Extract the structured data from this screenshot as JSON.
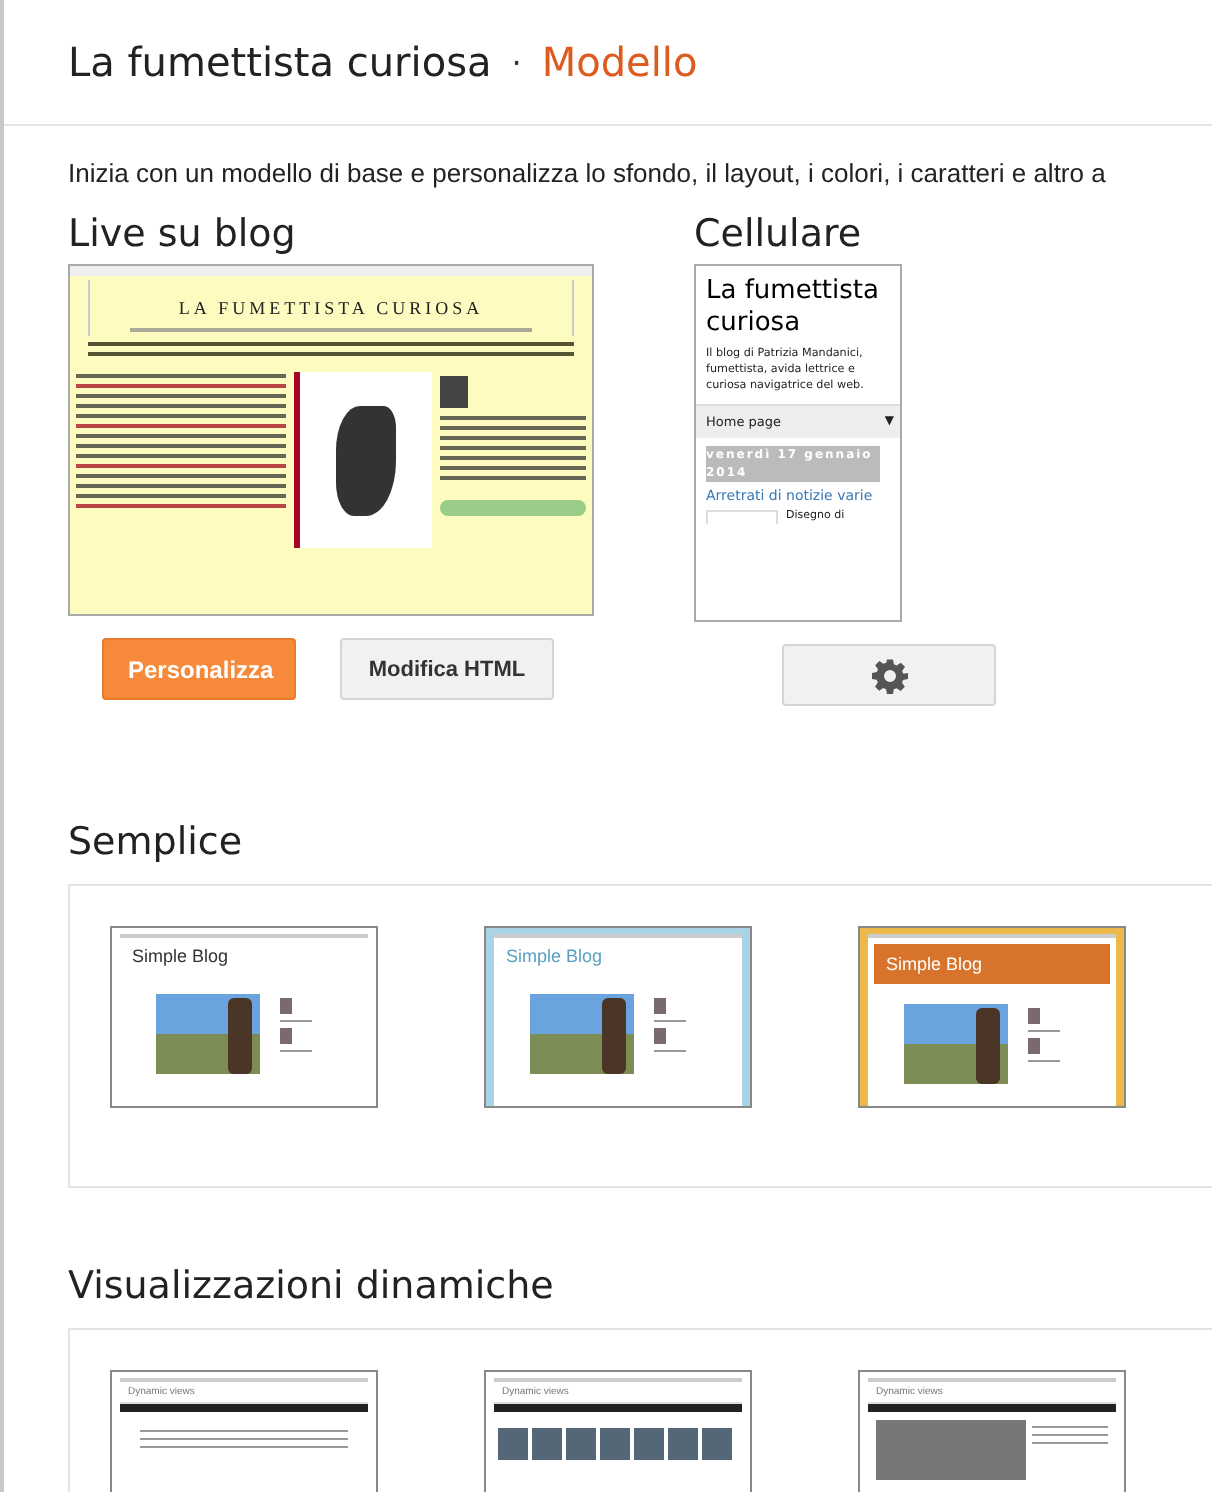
{
  "header": {
    "blog_name": "La fumettista curiosa",
    "separator": "·",
    "page": "Modello"
  },
  "intro": "Inizia con un modello di base e personalizza lo sfondo, il layout, i colori, i caratteri e altro a",
  "live": {
    "heading": "Live su blog",
    "preview_title": "LA FUMETTISTA CURIOSA",
    "buttons": [
      {
        "label": "Personalizza",
        "kind": "primary"
      },
      {
        "label": "Modifica HTML",
        "kind": "secondary"
      }
    ]
  },
  "mobile": {
    "heading": "Cellulare",
    "title": "La fumettista curiosa",
    "description": "Il blog di Patrizia Mandanici, fumettista, avida lettrice e curiosa navigatrice del web.",
    "menu": "Home page",
    "menu_caret": "▼",
    "date": "venerdì 17 gennaio 2014",
    "post_title": "Arretrati di notizie varie",
    "post_start": "Disegno di"
  },
  "sections": [
    {
      "heading": "Semplice",
      "templates": [
        {
          "title": "Simple Blog",
          "kind": "white"
        },
        {
          "title": "Simple Blog",
          "kind": "blue"
        },
        {
          "title": "Simple Blog",
          "kind": "orange"
        }
      ]
    },
    {
      "heading": "Visualizzazioni dinamiche",
      "templates": [
        {
          "title": "Dynamic views",
          "kind": "classic"
        },
        {
          "title": "Dynamic views",
          "kind": "flipcard"
        },
        {
          "title": "Dynamic views",
          "kind": "magazine"
        }
      ]
    }
  ]
}
